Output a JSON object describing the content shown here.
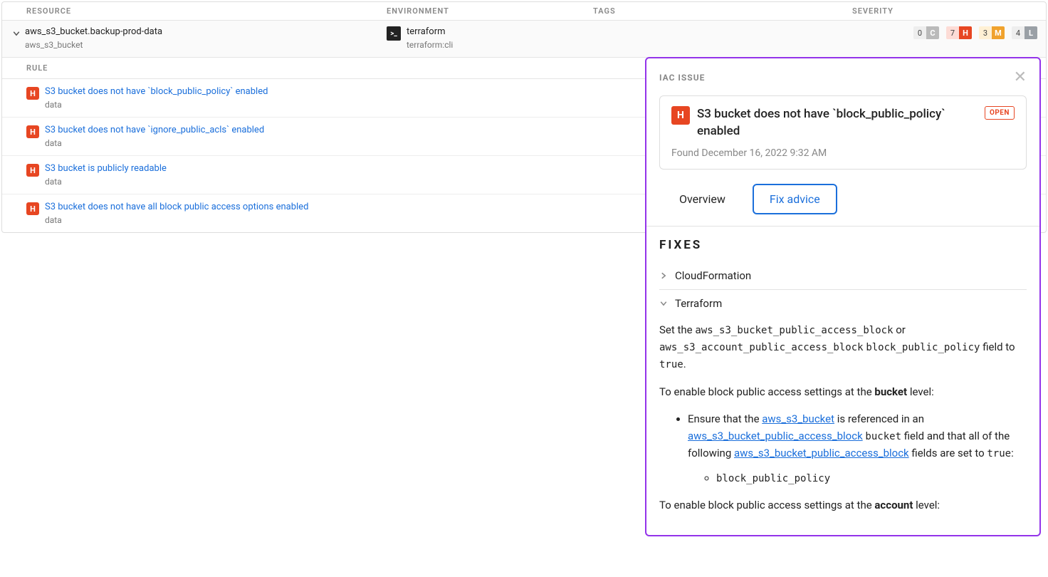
{
  "columns": {
    "resource": "RESOURCE",
    "environment": "ENVIRONMENT",
    "tags": "TAGS",
    "severity": "SEVERITY"
  },
  "resource": {
    "name": "aws_s3_bucket.backup-prod-data",
    "type": "aws_s3_bucket",
    "env_name": "terraform",
    "env_sub": "terraform:cli",
    "severity": {
      "C": "0",
      "H": "7",
      "M": "3",
      "L": "4"
    }
  },
  "rule_header": "RULE",
  "rules": [
    {
      "title": "S3 bucket does not have `block_public_policy` enabled",
      "sub": "data"
    },
    {
      "title": "S3 bucket does not have `ignore_public_acls` enabled",
      "sub": "data"
    },
    {
      "title": "S3 bucket is publicly readable",
      "sub": "data"
    },
    {
      "title": "S3 bucket does not have all block public access options enabled",
      "sub": "data"
    }
  ],
  "panel": {
    "header": "IAC ISSUE",
    "badge": "H",
    "title": "S3 bucket does not have `block_public_policy` enabled",
    "status": "OPEN",
    "found": "Found December 16, 2022 9:32 AM",
    "tab_overview": "Overview",
    "tab_fix": "Fix advice",
    "fixes_title": "FIXES",
    "fix_cf": "CloudFormation",
    "fix_tf": "Terraform",
    "tf_p1_a": "Set the ",
    "tf_p1_c1": "aws_s3_bucket_public_access_block",
    "tf_p1_b": " or ",
    "tf_p1_c2": "aws_s3_account_public_access_block",
    "tf_p1_c": " ",
    "tf_p1_c3": "block_public_policy",
    "tf_p1_d": " field to ",
    "tf_p1_c4": "true",
    "tf_p1_e": ".",
    "tf_p2_a": "To enable block public access settings at the ",
    "tf_p2_b": "bucket",
    "tf_p2_c": " level:",
    "tf_li1_a": "Ensure that the ",
    "tf_li1_l1": "aws_s3_bucket",
    "tf_li1_b": " is referenced in an ",
    "tf_li1_l2": "aws_s3_bucket_public_access_block",
    "tf_li1_c": " ",
    "tf_li1_code1": "bucket",
    "tf_li1_d": " field and that all of the following ",
    "tf_li1_l3": "aws_s3_bucket_public_access_block",
    "tf_li1_e": " fields are set to ",
    "tf_li1_code2": "true",
    "tf_li1_f": ":",
    "tf_subli": "block_public_policy",
    "tf_p3_a": "To enable block public access settings at the ",
    "tf_p3_b": "account",
    "tf_p3_c": " level:"
  }
}
